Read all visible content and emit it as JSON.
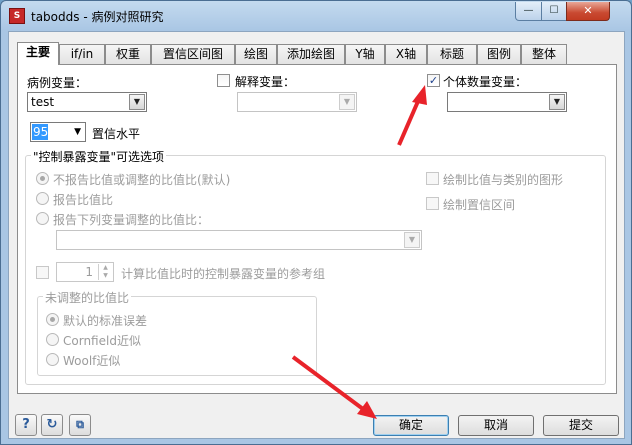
{
  "window": {
    "title": "tabodds - 病例对照研究",
    "icon_text": "Stata",
    "controls": {
      "minimize": "—",
      "maximize": "☐",
      "close": "✕"
    }
  },
  "tabs": [
    "主要",
    "if/in",
    "权重",
    "置信区间图",
    "绘图",
    "添加绘图",
    "Y轴",
    "X轴",
    "标题",
    "图例",
    "整体"
  ],
  "main": {
    "case_var_label": "病例变量：",
    "case_var_value": "test",
    "expl_var_label": "解释变量：",
    "expl_var_value": "",
    "expl_var_checked": false,
    "indiv_var_label": "个体数量变量：",
    "indiv_var_value": "",
    "indiv_var_checked": true,
    "conf_level_value": "95",
    "conf_level_label": "置信水平",
    "exposure_group_label": "\"控制暴露变量\"可选选项",
    "radio_no_report": "不报告比值或调整的比值比(默认)",
    "radio_report_or": "报告比值比",
    "radio_report_adjusted": "报告下列变量调整的比值比：",
    "adjust_vars_value": "",
    "check_plot_ratio": "绘制比值与类别的图形",
    "check_plot_ci": "绘制置信区间",
    "ref_spin_value": "1",
    "ref_group_label": "计算比值比时的控制暴露变量的参考组",
    "unadjusted_group_label": "未调整的比值比",
    "radio_default_se": "默认的标准误差",
    "radio_cornfield": "Cornfield近似",
    "radio_woolf": "Woolf近似"
  },
  "buttons": {
    "ok": "确定",
    "cancel": "取消",
    "submit": "提交"
  },
  "icons": [
    "help-icon",
    "reset-icon",
    "copy-icon"
  ],
  "colors": {
    "title_bar": "#a9c6e4",
    "close_button": "#c94a31",
    "annotation_arrow": "#e8232a",
    "selection": "#3399ff"
  }
}
